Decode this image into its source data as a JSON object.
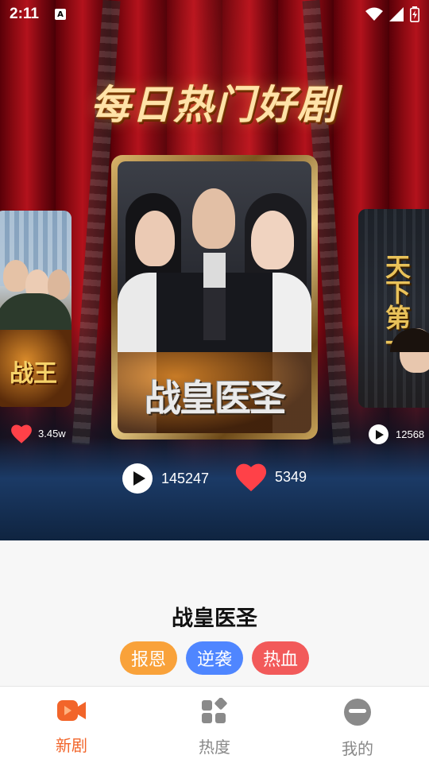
{
  "status_bar": {
    "time": "2:11",
    "notification_icon": "A"
  },
  "banner": {
    "title": "每日热门好剧"
  },
  "carousel": {
    "center": {
      "poster_title": "战皇医圣",
      "plays": "145247",
      "likes": "5349"
    },
    "left": {
      "poster_title": "战王",
      "likes": "3.45w"
    },
    "right": {
      "poster_title": "天下第一",
      "plays": "12568"
    }
  },
  "drama": {
    "title": "战皇医圣",
    "tags": [
      {
        "label": "报恩",
        "color": "#f9a23a"
      },
      {
        "label": "逆袭",
        "color": "#4f86ff"
      },
      {
        "label": "热血",
        "color": "#f25a5a"
      }
    ]
  },
  "tabbar": {
    "active_color": "#f2652a",
    "inactive_color": "#888888",
    "items": [
      {
        "label": "新剧",
        "icon": "video-camera-icon",
        "active": true
      },
      {
        "label": "热度",
        "icon": "apps-grid-icon",
        "active": false
      },
      {
        "label": "我的",
        "icon": "profile-face-icon",
        "active": false
      }
    ]
  }
}
